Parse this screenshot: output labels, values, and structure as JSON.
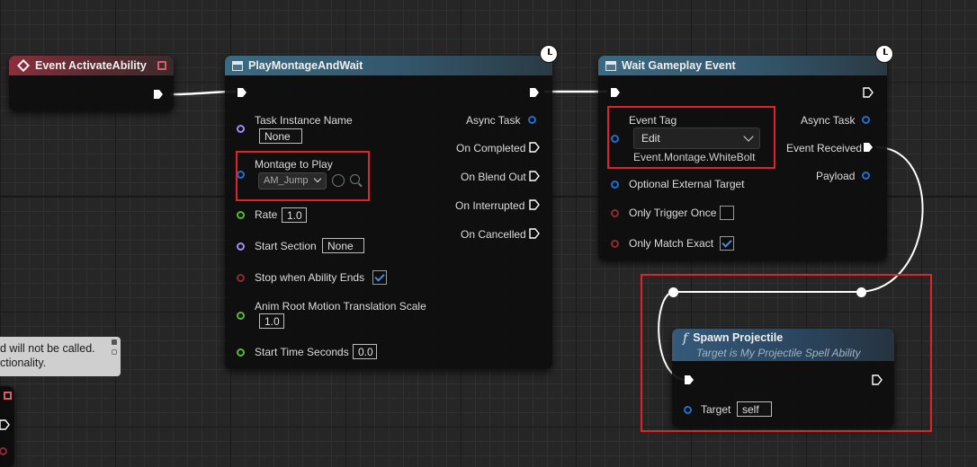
{
  "nodes": {
    "activate": {
      "title": "Event ActivateAbility"
    },
    "play_montage": {
      "title": "PlayMontageAndWait",
      "inputs": {
        "task_instance_name": "Task Instance Name",
        "task_instance_value": "None",
        "montage_to_play": "Montage to Play",
        "montage_value": "AM_Jump",
        "rate": "Rate",
        "rate_value": "1.0",
        "start_section": "Start Section",
        "start_section_value": "None",
        "stop_when_ability_ends": "Stop when Ability Ends",
        "stop_when_ability_ends_checked": true,
        "anim_root_motion": "Anim Root Motion Translation Scale",
        "anim_root_motion_value": "1.0",
        "start_time_seconds": "Start Time Seconds",
        "start_time_seconds_value": "0.0"
      },
      "outputs": {
        "async_task": "Async Task",
        "on_completed": "On Completed",
        "on_blend_out": "On Blend Out",
        "on_interrupted": "On Interrupted",
        "on_cancelled": "On Cancelled"
      }
    },
    "wait_event": {
      "title": "Wait Gameplay Event",
      "inputs": {
        "event_tag": "Event Tag",
        "event_tag_dropdown": "Edit",
        "event_tag_value": "Event.Montage.WhiteBolt",
        "optional_external_target": "Optional External Target",
        "only_trigger_once": "Only Trigger Once",
        "only_trigger_once_checked": false,
        "only_match_exact": "Only Match Exact",
        "only_match_exact_checked": true
      },
      "outputs": {
        "async_task": "Async Task",
        "event_received": "Event Received",
        "payload": "Payload"
      }
    },
    "spawn_projectile": {
      "title": "Spawn Projectile",
      "subtitle": "Target is My Projectile Spell Ability",
      "inputs": {
        "target": "Target",
        "target_value": "self"
      }
    }
  },
  "comment": {
    "line1": "d will not be called.",
    "line2": "ctionality."
  },
  "colors": {
    "exec_pin": "#ffffff",
    "object_pin": "#1f6fd0",
    "float_pin": "#58b83a",
    "bool_pin": "#8e2a34",
    "name_pin": "#a58cf0",
    "highlight": "#e0242c",
    "event_header": "#8a2f3c",
    "task_header": "#3a6a82"
  }
}
